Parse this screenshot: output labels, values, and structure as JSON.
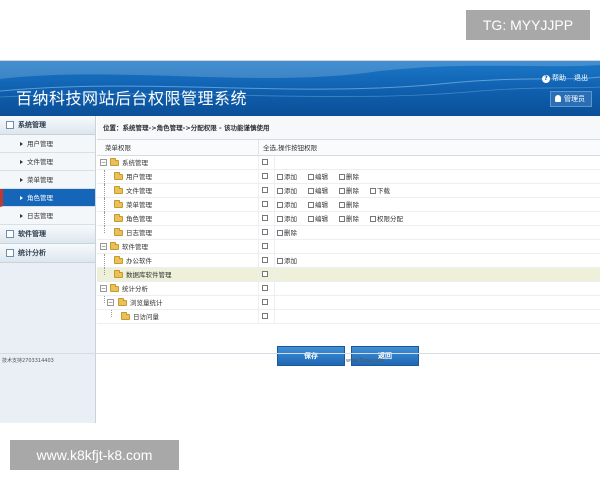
{
  "watermarks": {
    "top": "TG: MYYJJPP",
    "bottom": "www.k8kfjt-k8.com"
  },
  "header": {
    "title": "百纳科技网站后台权限管理系统",
    "help": "帮助",
    "logout": "退出",
    "user_button": "管理员"
  },
  "sidebar": {
    "sections": [
      {
        "label": "系统管理",
        "items": [
          "用户管理",
          "文件管理",
          "菜单管理",
          "角色管理",
          "日志管理"
        ],
        "active": "角色管理"
      },
      {
        "label": "软件管理"
      },
      {
        "label": "统计分析"
      }
    ]
  },
  "breadcrumb": "位置：系统管理->角色管理->分配权限 - 该功能谨慎使用",
  "table": {
    "col1": "菜单权限",
    "col2": "全选,操作按钮权限",
    "rows": [
      {
        "name": "系统管理",
        "perms": []
      },
      {
        "name": "用户管理",
        "perms": [
          "添加",
          "编辑",
          "删除"
        ]
      },
      {
        "name": "文件管理",
        "perms": [
          "添加",
          "编辑",
          "删除",
          "下载"
        ]
      },
      {
        "name": "菜单管理",
        "perms": [
          "添加",
          "编辑",
          "删除"
        ]
      },
      {
        "name": "角色管理",
        "perms": [
          "添加",
          "编辑",
          "删除",
          "权限分配"
        ]
      },
      {
        "name": "日志管理",
        "perms": [
          "删除"
        ]
      },
      {
        "name": "软件管理",
        "perms": []
      },
      {
        "name": "办公软件",
        "perms": [
          "添加"
        ]
      },
      {
        "name": "数据库软件管理",
        "perms": []
      },
      {
        "name": "统计分析",
        "perms": []
      },
      {
        "name": "浏览量统计",
        "perms": []
      },
      {
        "name": "日访问量",
        "perms": []
      }
    ]
  },
  "buttons": {
    "save": "保存",
    "back": "返回"
  },
  "footer": {
    "left": "技术支持2703314403",
    "right": "www.Tvne.com"
  },
  "colors": {
    "header_blue": "#0f5fae",
    "active_item": "#1565b8",
    "highlight_row": "#eef0d9"
  }
}
